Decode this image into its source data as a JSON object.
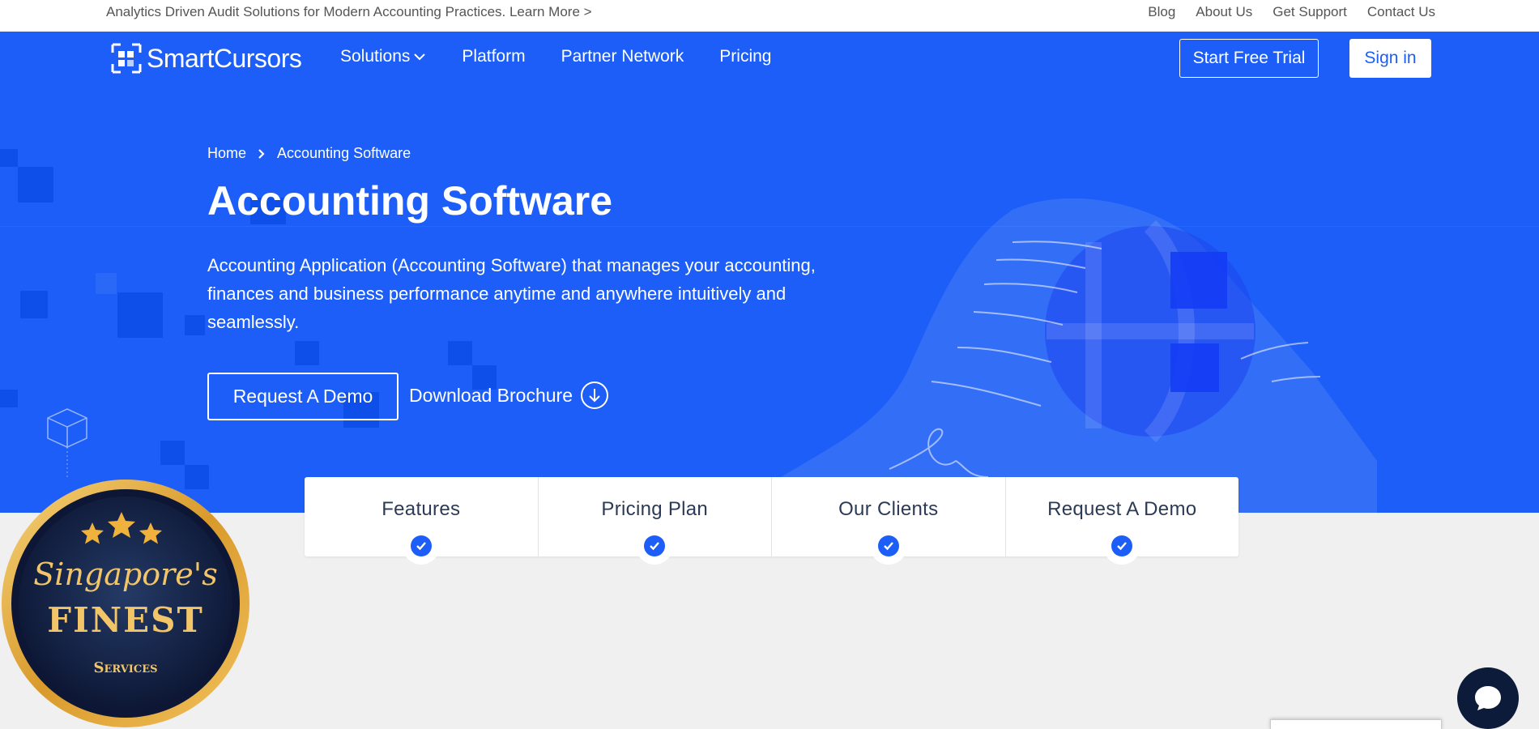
{
  "topbar": {
    "promo": "Analytics Driven Audit Solutions for Modern Accounting Practices. Learn More >",
    "links": [
      "Blog",
      "About Us",
      "Get Support",
      "Contact Us"
    ]
  },
  "nav": {
    "logo_text": "SmartCursors",
    "items": [
      "Solutions",
      "Platform",
      "Partner Network",
      "Pricing"
    ],
    "start_trial": "Start Free Trial",
    "sign_in": "Sign in"
  },
  "hero": {
    "breadcrumb": [
      "Home",
      "Accounting Software"
    ],
    "title": "Accounting Software",
    "description": "Accounting Application (Accounting Software) that manages your accounting, finances and business performance anytime and anywhere intuitively and seamlessly.",
    "demo_button": "Request A Demo",
    "brochure_button": "Download Brochure"
  },
  "tabs": [
    "Features",
    "Pricing Plan",
    "Our Clients",
    "Request A Demo"
  ],
  "badge": {
    "line1": "Singapore's",
    "line2": "FINEST",
    "line3": "Services"
  },
  "colors": {
    "brand_blue": "#1c5ef7",
    "page_bg": "#f0f0f0",
    "tab_text": "#2d3a55",
    "chat_bg": "#0d1b3a",
    "badge_gold": "#e0a93a"
  },
  "icons": {
    "chevron": "chevron-down-icon",
    "breadcrumb_sep": "chevron-right-icon",
    "download": "arrow-down-circle-icon",
    "check": "check-circle-icon",
    "chat": "chat-bubble-icon"
  }
}
